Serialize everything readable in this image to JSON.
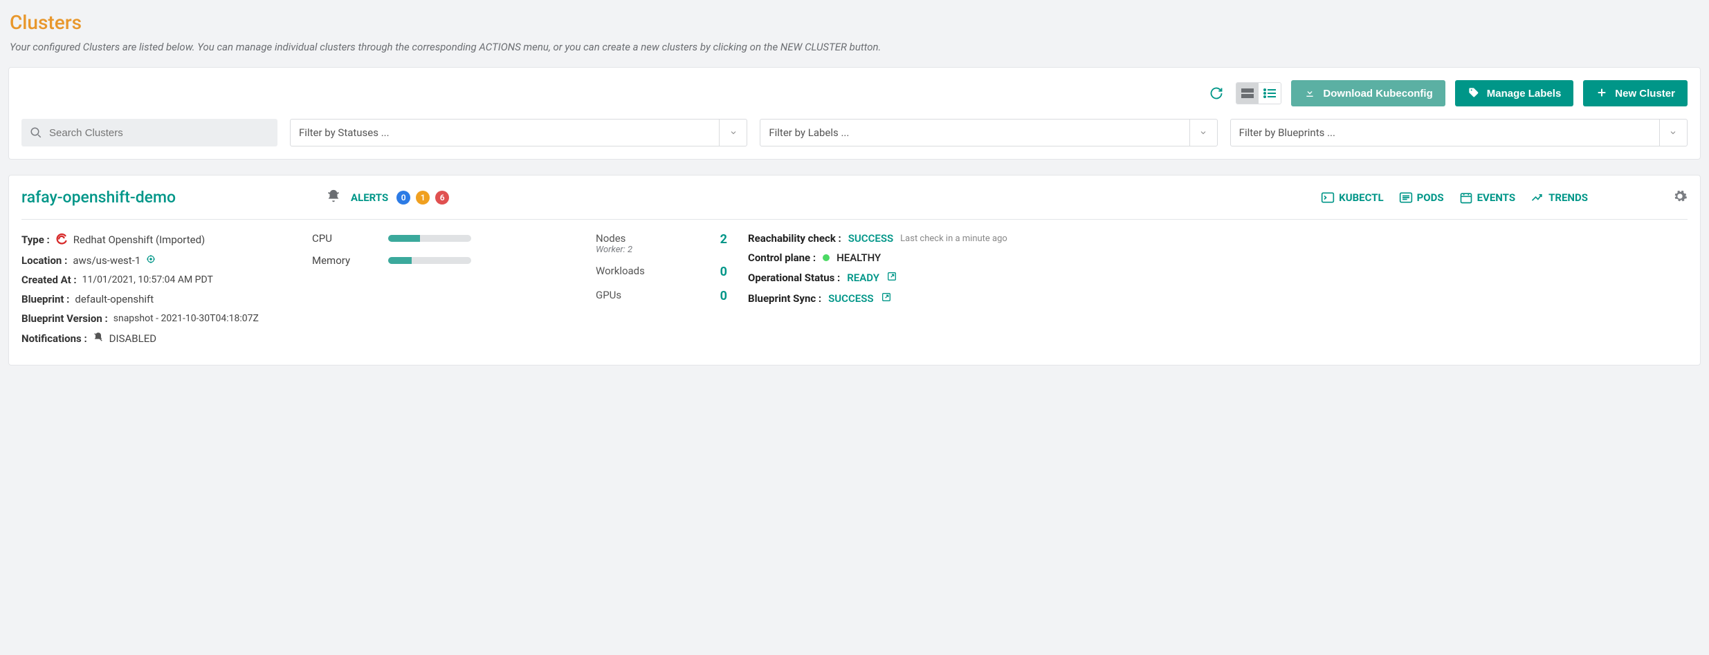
{
  "page": {
    "title": "Clusters",
    "subtitle": "Your configured Clusters are listed below. You can manage individual clusters through the corresponding ACTIONS menu, or you can create a new clusters by clicking on the NEW CLUSTER button."
  },
  "toolbar": {
    "download_label": "Download Kubeconfig",
    "manage_labels_label": "Manage Labels",
    "new_cluster_label": "New Cluster",
    "search_placeholder": "Search Clusters",
    "filter_status_placeholder": "Filter by Statuses ...",
    "filter_labels_placeholder": "Filter by Labels ...",
    "filter_blueprints_placeholder": "Filter by Blueprints ..."
  },
  "cluster": {
    "name": "rafay-openshift-demo",
    "alerts_label": "ALERTS",
    "alerts": {
      "info": "0",
      "warning": "1",
      "critical": "6"
    },
    "links": {
      "kubectl": "KUBECTL",
      "pods": "PODS",
      "events": "EVENTS",
      "trends": "TRENDS"
    },
    "details": {
      "type_label": "Type :",
      "type_value": "Redhat Openshift (Imported)",
      "location_label": "Location :",
      "location_value": "aws/us-west-1",
      "created_label": "Created At :",
      "created_value": "11/01/2021, 10:57:04 AM PDT",
      "blueprint_label": "Blueprint :",
      "blueprint_value": "default-openshift",
      "bp_version_label": "Blueprint Version :",
      "bp_version_value": "snapshot - 2021-10-30T04:18:07Z",
      "notifications_label": "Notifications :",
      "notifications_value": "DISABLED"
    },
    "resources": {
      "cpu_label": "CPU",
      "cpu_percent": 38,
      "memory_label": "Memory",
      "memory_percent": 28
    },
    "stats": {
      "nodes_label": "Nodes",
      "nodes_value": "2",
      "nodes_sub": "Worker: 2",
      "workloads_label": "Workloads",
      "workloads_value": "0",
      "gpus_label": "GPUs",
      "gpus_value": "0"
    },
    "status": {
      "reachability_label": "Reachability check :",
      "reachability_value": "SUCCESS",
      "reachability_note": "Last check in a minute ago",
      "control_plane_label": "Control plane :",
      "control_plane_value": "HEALTHY",
      "op_status_label": "Operational Status :",
      "op_status_value": "READY",
      "bp_sync_label": "Blueprint Sync :",
      "bp_sync_value": "SUCCESS"
    }
  }
}
